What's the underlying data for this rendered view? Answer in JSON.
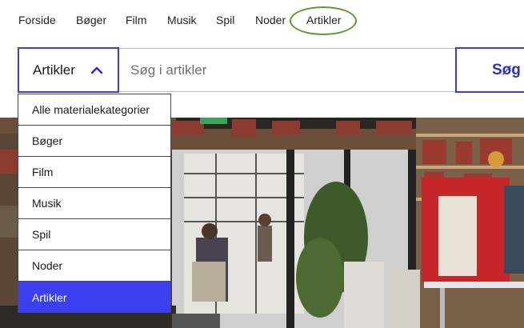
{
  "nav": {
    "items": [
      "Forside",
      "Bøger",
      "Film",
      "Musik",
      "Spil",
      "Noder",
      "Artikler"
    ]
  },
  "search": {
    "category_label": "Artikler",
    "placeholder": "Søg i artikler",
    "button_label": "Søg"
  },
  "dropdown": {
    "options": [
      "Alle materialekategorier",
      "Bøger",
      "Film",
      "Musik",
      "Spil",
      "Noder",
      "Artikler"
    ],
    "selected": "Artikler"
  },
  "icons": {
    "select_toggle": "chevron-up-icon"
  },
  "colors": {
    "accent": "#3a3fd1",
    "selected_option": "#3c3ff0",
    "highlight_ring": "#5a9a2e"
  }
}
